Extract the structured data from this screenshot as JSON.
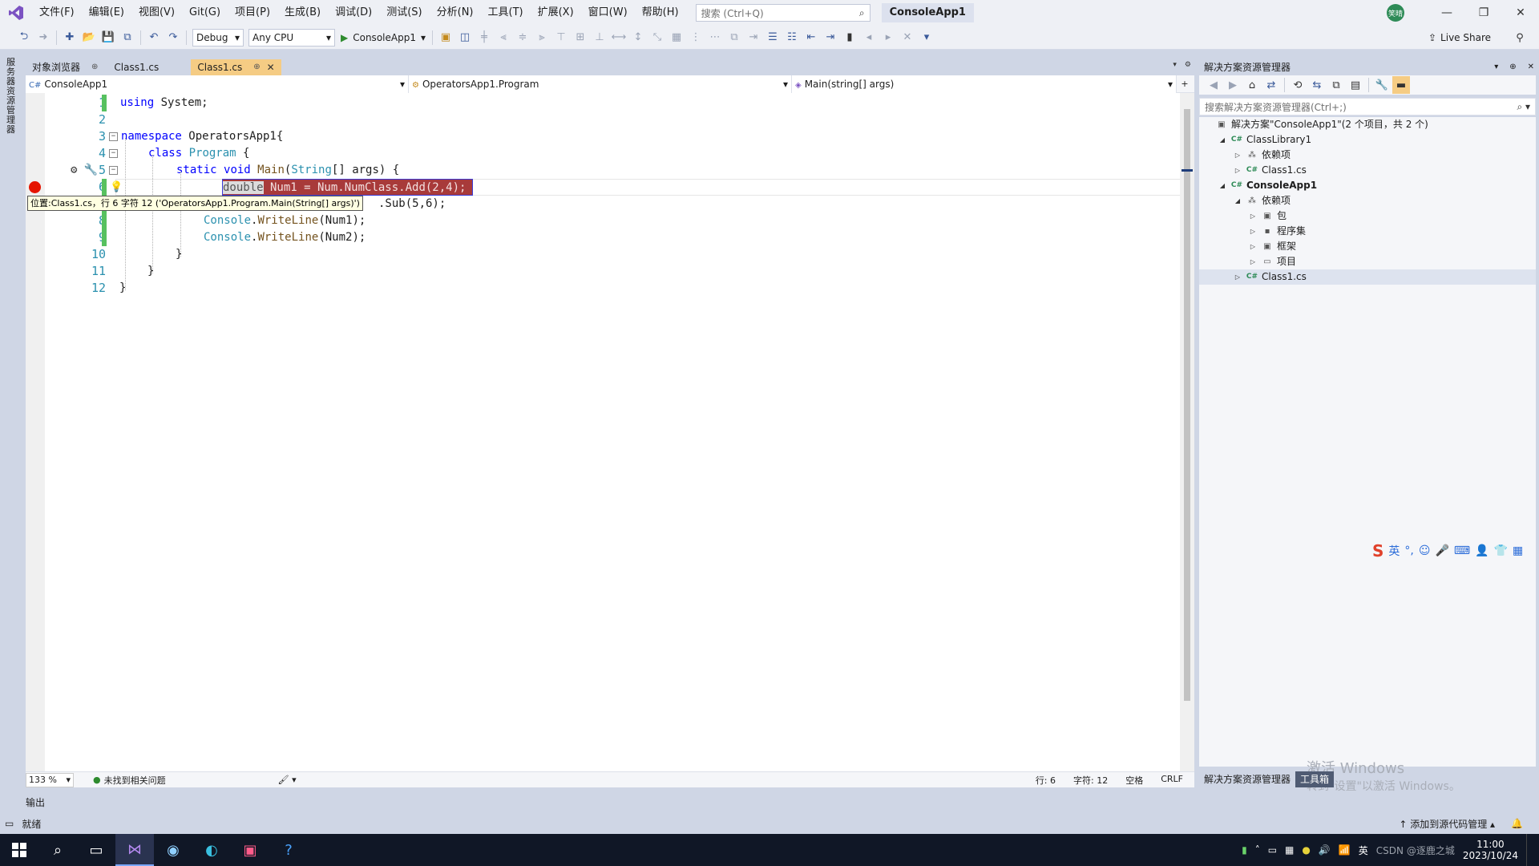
{
  "menu": [
    "文件(F)",
    "编辑(E)",
    "视图(V)",
    "Git(G)",
    "项目(P)",
    "生成(B)",
    "调试(D)",
    "测试(S)",
    "分析(N)",
    "工具(T)",
    "扩展(X)",
    "窗口(W)",
    "帮助(H)"
  ],
  "search": {
    "placeholder": "搜索 (Ctrl+Q)"
  },
  "app_title": "ConsoleApp1",
  "avatar_text": "笑晴",
  "toolbar": {
    "config": "Debug",
    "platform": "Any CPU",
    "run_label": "ConsoleApp1",
    "live_share": "Live Share"
  },
  "left_strip_label": "服务器资源管理器",
  "tabs": [
    {
      "label": "对象浏览器",
      "pin": "⊕"
    },
    {
      "label": "Class1.cs"
    },
    {
      "label": "Class1.cs",
      "pin": "⊕",
      "close": "✕"
    }
  ],
  "nav": {
    "project": "ConsoleApp1",
    "type": "OperatorsApp1.Program",
    "member": "Main(string[] args)"
  },
  "code": {
    "line_numbers": [
      "1",
      "2",
      "3",
      "4",
      "5",
      "6",
      "7",
      "8",
      "9",
      "10",
      "11",
      "12"
    ],
    "l1_kw": "using",
    "l1_rest": " System;",
    "l3_kw": "namespace",
    "l3_rest": " OperatorsApp1{",
    "l4_kw": "class",
    "l4_ty": "Program",
    "l4_rest": " {",
    "l5_kw1": "static",
    "l5_kw2": "void",
    "l5_mt": "Main",
    "l5_ty": "String",
    "l5_rest": "[] args) {",
    "l6_sel": "double",
    "l6_rest": " Num1 = Num.NumClass.Add(2,4);",
    "l7_visible": ".Sub(5,6);",
    "l8_ty": "Console",
    "l8_mt": "WriteLine",
    "l8_rest": "(Num1);",
    "l9_rest": "(Num2);",
    "l10": "}",
    "l11": "}",
    "l12": "}"
  },
  "tooltip": "位置:Class1.cs，行 6 字符 12 ('OperatorsApp1.Program.Main(String[] args)')",
  "editor_status": {
    "zoom": "133 %",
    "issues": "未找到相关问题",
    "line": "行: 6",
    "char": "字符: 12",
    "spaces": "空格",
    "eol": "CRLF"
  },
  "output_label": "输出",
  "solution": {
    "title": "解决方案资源管理器",
    "search_placeholder": "搜索解决方案资源管理器(Ctrl+;)",
    "items": [
      {
        "label": "解决方案\"ConsoleApp1\"(2 个项目，共 2 个)",
        "level": 0,
        "expander": "",
        "icon": "▣"
      },
      {
        "label": "ClassLibrary1",
        "level": 1,
        "expander": "◢",
        "icon": "C#"
      },
      {
        "label": "依赖项",
        "level": 2,
        "expander": "▷",
        "icon": "⁂"
      },
      {
        "label": "Class1.cs",
        "level": 2,
        "expander": "▷",
        "icon": "C#"
      },
      {
        "label": "ConsoleApp1",
        "level": 1,
        "expander": "◢",
        "icon": "C#",
        "bold": true
      },
      {
        "label": "依赖项",
        "level": 2,
        "expander": "◢",
        "icon": "⁂"
      },
      {
        "label": "包",
        "level": 3,
        "expander": "▷",
        "icon": "▣"
      },
      {
        "label": "程序集",
        "level": 3,
        "expander": "▷",
        "icon": "▪"
      },
      {
        "label": "框架",
        "level": 3,
        "expander": "▷",
        "icon": "▣"
      },
      {
        "label": "项目",
        "level": 3,
        "expander": "▷",
        "icon": "▭"
      },
      {
        "label": "Class1.cs",
        "level": 2,
        "expander": "▷",
        "icon": "C#",
        "selected": true
      }
    ],
    "bottom_tabs": [
      "解决方案资源管理器",
      "工具箱"
    ]
  },
  "ime": {
    "mode": "英"
  },
  "activate": {
    "title": "激活 Windows",
    "sub": "转到\"设置\"以激活 Windows。"
  },
  "status": {
    "ready": "就绪",
    "source_control": "添加到源代码管理"
  },
  "taskbar": {
    "ime": "英",
    "time": "11:00",
    "date": "2023/10/24",
    "watermark": "CSDN @逐鹿之城"
  }
}
